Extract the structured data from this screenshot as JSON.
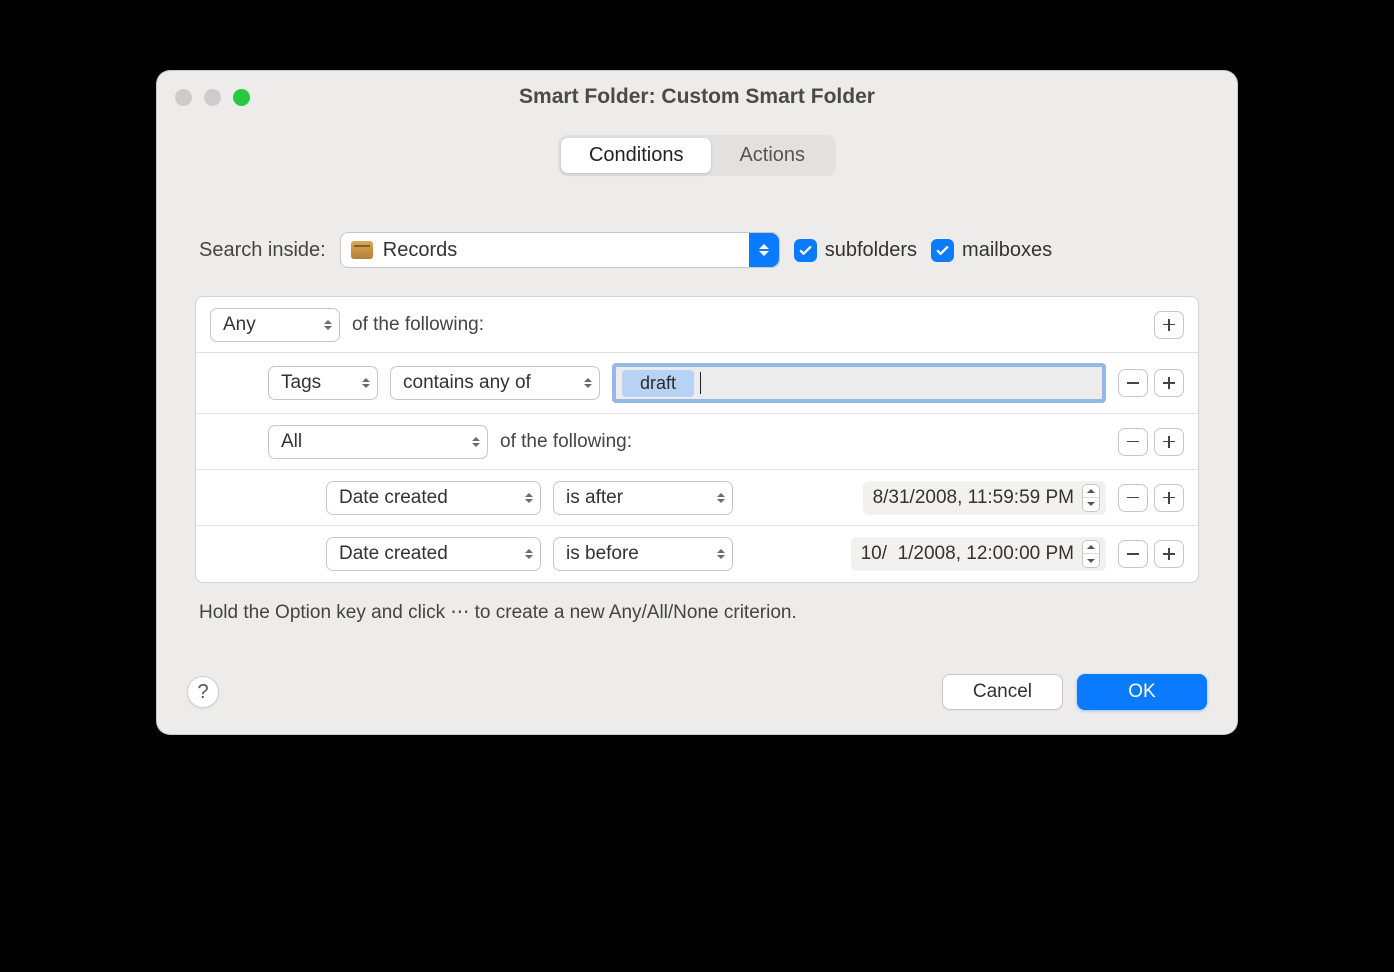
{
  "window": {
    "title": "Smart Folder: Custom Smart Folder"
  },
  "tabs": {
    "conditions": "Conditions",
    "actions": "Actions",
    "active": "conditions"
  },
  "search": {
    "label": "Search inside:",
    "folder": "Records",
    "subfolders_label": "subfolders",
    "mailboxes_label": "mailboxes",
    "subfolders_checked": true,
    "mailboxes_checked": true
  },
  "rules": {
    "group0": {
      "match": "Any",
      "suffix": "of the following:"
    },
    "row_tags": {
      "field": "Tags",
      "op": "contains any of",
      "token": "draft"
    },
    "group1": {
      "match": "All",
      "suffix": "of the following:"
    },
    "row_date1": {
      "field": "Date created",
      "op": "is after",
      "value": "8/31/2008, 11:59:59 PM"
    },
    "row_date2": {
      "field": "Date created",
      "op": "is before",
      "value": "10/  1/2008, 12:00:00 PM"
    }
  },
  "hint": "Hold the Option key and click ⋯ to create a new Any/All/None criterion.",
  "footer": {
    "help": "?",
    "cancel": "Cancel",
    "ok": "OK"
  }
}
